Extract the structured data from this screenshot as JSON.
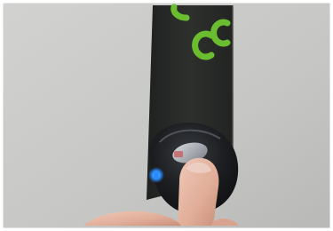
{
  "photo": {
    "strap_logo_text": "CC",
    "colors": {
      "wall": "#c9c9c7",
      "strap": "#2b2d2b",
      "logo_green": "#6abd2e",
      "device_shell": "#1d1f22",
      "indicator_led": "#2a8cff",
      "skin": "#e2b39f"
    }
  }
}
